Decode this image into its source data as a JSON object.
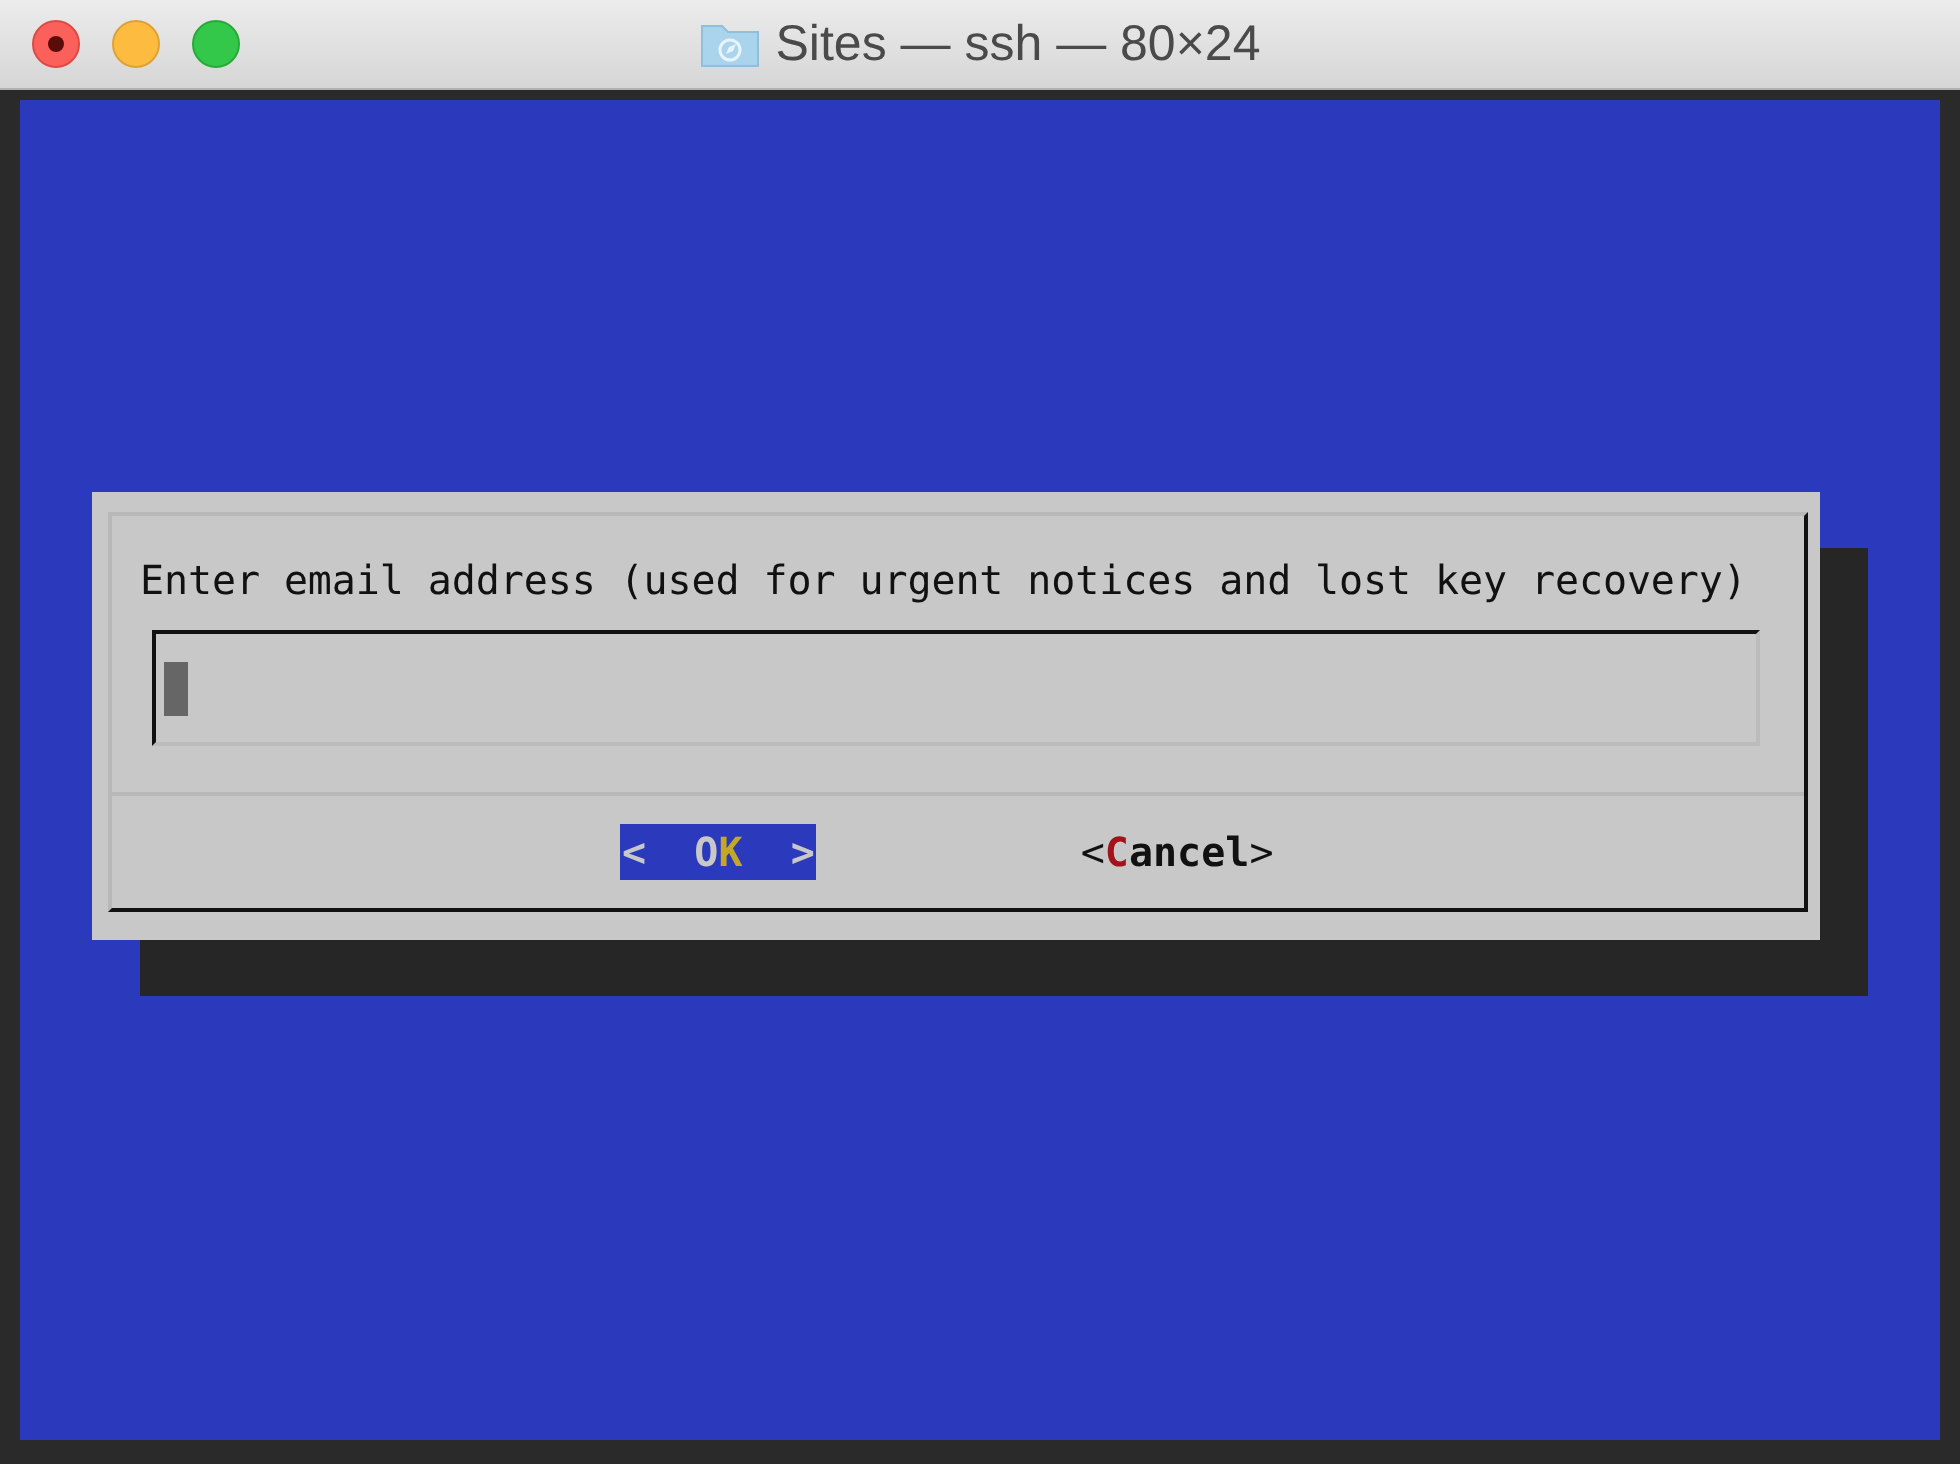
{
  "window": {
    "title": "Sites — ssh — 80×24"
  },
  "dialog": {
    "prompt": "Enter email address (used for urgent notices and lost key recovery)",
    "input": {
      "focused": true
    },
    "buttons": [
      {
        "open": "<",
        "before": "O",
        "hotkey": "K",
        "close": ">",
        "selected": true
      },
      {
        "open": "<",
        "hotkey": "C",
        "after": "ancel",
        "close": ">",
        "selected": false
      }
    ]
  }
}
